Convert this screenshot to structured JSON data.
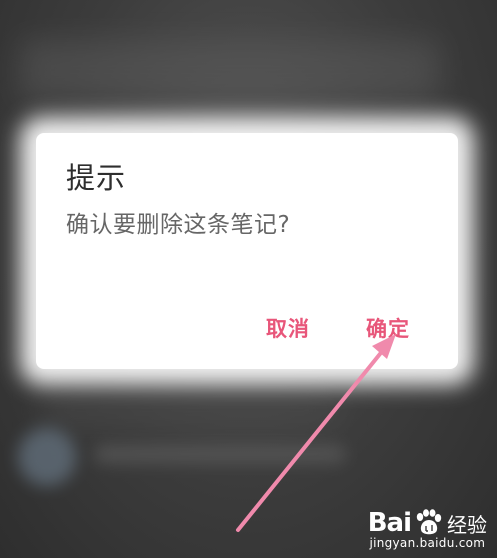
{
  "dialog": {
    "title": "提示",
    "message": "确认要删除这条笔记?",
    "cancel_label": "取消",
    "confirm_label": "确定"
  },
  "watermark": {
    "brand": "Bai",
    "name": "经验",
    "url": "jingyan.baidu.com"
  },
  "colors": {
    "accent": "#e8567a",
    "arrow": "#f08aac"
  },
  "icons": {
    "logo": "baidu-paw-icon",
    "pointer": "arrow-annotation-icon"
  }
}
